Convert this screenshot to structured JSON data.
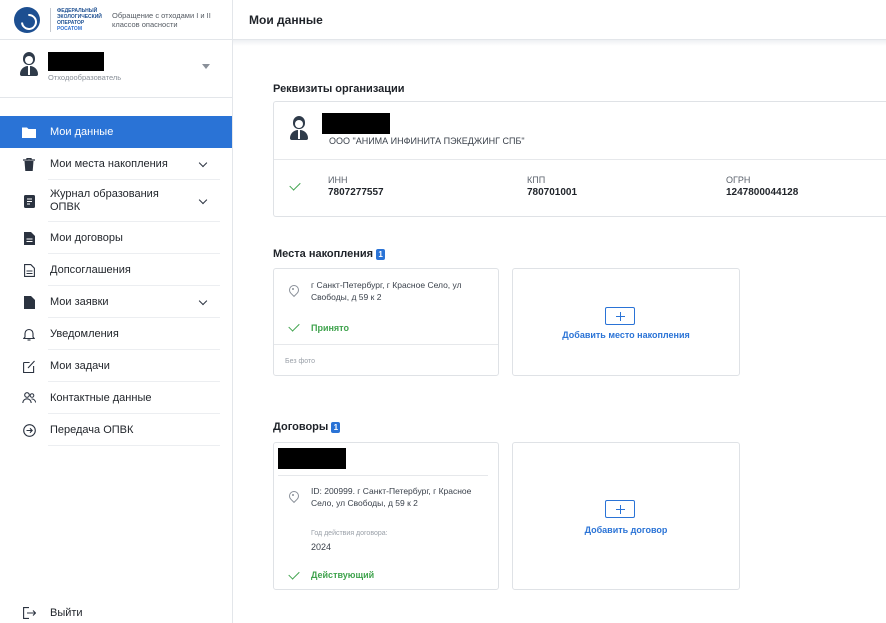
{
  "logo": {
    "org_line1": "ФЕДЕРАЛЬНЫЙ",
    "org_line2": "ЭКОЛОГИЧЕСКИЙ",
    "org_line3": "ОПЕРАТОР",
    "org_line4": "РОСАТОМ",
    "title": "Обращение с отходами I и II классов опасности"
  },
  "user": {
    "role": "Отходообразователь"
  },
  "nav": [
    {
      "label": "Мои данные",
      "icon": "folder-icon",
      "active": true
    },
    {
      "label": "Мои места накопления",
      "icon": "trash-icon",
      "expandable": true
    },
    {
      "label": "Журнал образования ОПВК",
      "icon": "journal-icon",
      "expandable": true
    },
    {
      "label": "Мои договоры",
      "icon": "document-icon"
    },
    {
      "label": "Допсоглашения",
      "icon": "document-outline-icon"
    },
    {
      "label": "Мои заявки",
      "icon": "request-icon",
      "expandable": true
    },
    {
      "label": "Уведомления",
      "icon": "bell-icon"
    },
    {
      "label": "Мои задачи",
      "icon": "edit-task-icon"
    },
    {
      "label": "Контактные данные",
      "icon": "contacts-icon"
    },
    {
      "label": "Передача ОПВК",
      "icon": "transfer-icon"
    }
  ],
  "logout": {
    "label": "Выйти",
    "icon": "logout-icon"
  },
  "header": {
    "title": "Мои данные"
  },
  "requisites": {
    "section_title": "Реквизиты организации",
    "org_name": "ООО \"АНИМА ИНФИНИТА ПЭКЕДЖИНГ СПБ\"",
    "inn_label": "ИНН",
    "inn_value": "7807277557",
    "kpp_label": "КПП",
    "kpp_value": "780701001",
    "ogrn_label": "ОГРН",
    "ogrn_value": "1247800044128"
  },
  "locations": {
    "section_title": "Места накопления",
    "count": "1",
    "item": {
      "address": "г Санкт-Петербург, г Красное Село, ул Свободы, д 59 к 2",
      "status": "Принято",
      "photo": "Без фото"
    },
    "add_label": "Добавить место накопления"
  },
  "contracts": {
    "section_title": "Договоры",
    "count": "1",
    "item": {
      "address": "ID: 200999. г Санкт-Петербург, г Красное Село, ул Свободы, д 59 к 2",
      "year_label": "Год действия договора:",
      "year": "2024",
      "status": "Действующий"
    },
    "add_label": "Добавить договор"
  },
  "colors": {
    "accent": "#2a73d6",
    "success": "#3fa34d",
    "brand": "#1d4f91"
  }
}
